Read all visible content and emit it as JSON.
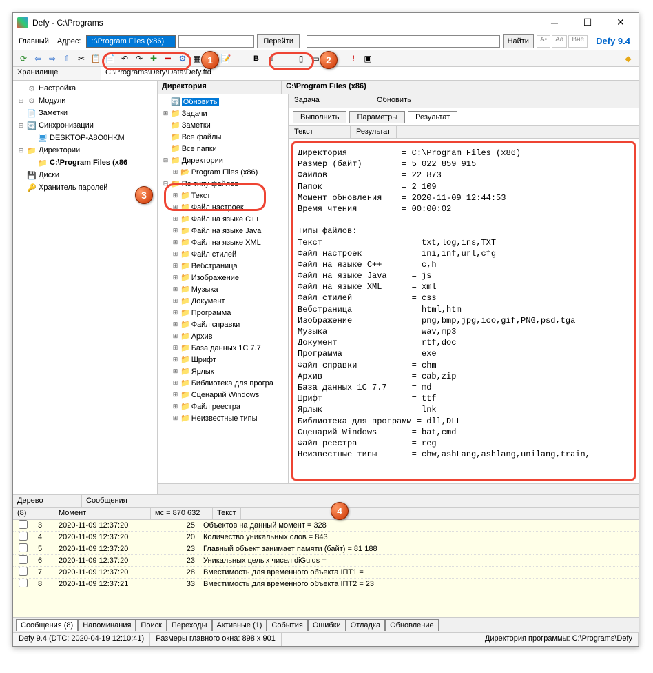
{
  "window": {
    "title": "Defy - C:\\Programs"
  },
  "addressbar": {
    "main_label": "Главный",
    "addr_label": "Адрес:",
    "addr_value": "::\\Program Files (x86)",
    "go_label": "Перейти",
    "find_label": "Найти",
    "font_a": "A•",
    "font_aa": "Aa",
    "font_vne": "Вне",
    "version": "Defy 9.4"
  },
  "pathbar": {
    "label": "Хранилище",
    "path": "C:\\Programs\\Defy\\Data\\Defy.ftd"
  },
  "tree": {
    "items": [
      {
        "exp": "",
        "ico": "gear",
        "txt": "Настройка",
        "ind": 0
      },
      {
        "exp": "⊞",
        "ico": "gear",
        "txt": "Модули",
        "ind": 0
      },
      {
        "exp": "",
        "ico": "note",
        "txt": "Заметки",
        "ind": 0
      },
      {
        "exp": "⊟",
        "ico": "sync",
        "txt": "Синхронизации",
        "ind": 0
      },
      {
        "exp": "",
        "ico": "comp",
        "txt": "DESKTOP-A8O0HKM",
        "ind": 1
      },
      {
        "exp": "⊟",
        "ico": "folder",
        "txt": "Директории",
        "ind": 0
      },
      {
        "exp": "",
        "ico": "folder",
        "txt": "C:\\Program Files (x86",
        "ind": 1,
        "bold": true
      },
      {
        "exp": "",
        "ico": "disk",
        "txt": "Диски",
        "ind": 0
      },
      {
        "exp": "",
        "ico": "key",
        "txt": "Хранитель паролей",
        "ind": 0
      }
    ]
  },
  "mid_header": {
    "col1": "Директория",
    "col2": "C:\\Program Files (x86)"
  },
  "filetree": {
    "items": [
      {
        "exp": "",
        "ico": "🔄",
        "txt": "Обновить",
        "ind": 0,
        "sel": true
      },
      {
        "exp": "⊞",
        "ico": "📁",
        "txt": "Задачи",
        "ind": 0
      },
      {
        "exp": "",
        "ico": "📁",
        "txt": "Заметки",
        "ind": 0
      },
      {
        "exp": "",
        "ico": "📁",
        "txt": "Все файлы",
        "ind": 0
      },
      {
        "exp": "",
        "ico": "📁",
        "txt": "Все папки",
        "ind": 0
      },
      {
        "exp": "⊟",
        "ico": "📁",
        "txt": "Директории",
        "ind": 0
      },
      {
        "exp": "⊞",
        "ico": "📂",
        "txt": "Program Files (x86)",
        "ind": 1,
        "yel": true
      },
      {
        "exp": "⊟",
        "ico": "📁",
        "txt": "По типу файлов",
        "ind": 0
      },
      {
        "exp": "⊞",
        "ico": "📁",
        "txt": "Текст",
        "ind": 1
      },
      {
        "exp": "⊞",
        "ico": "📁",
        "txt": "Файл настроек",
        "ind": 1
      },
      {
        "exp": "⊞",
        "ico": "📁",
        "txt": "Файл на языке C++",
        "ind": 1
      },
      {
        "exp": "⊞",
        "ico": "📁",
        "txt": "Файл на языке Java",
        "ind": 1
      },
      {
        "exp": "⊞",
        "ico": "📁",
        "txt": "Файл на языке XML",
        "ind": 1
      },
      {
        "exp": "⊞",
        "ico": "📁",
        "txt": "Файл стилей",
        "ind": 1
      },
      {
        "exp": "⊞",
        "ico": "📁",
        "txt": "Вебстраница",
        "ind": 1
      },
      {
        "exp": "⊞",
        "ico": "📁",
        "txt": "Изображение",
        "ind": 1
      },
      {
        "exp": "⊞",
        "ico": "📁",
        "txt": "Музыка",
        "ind": 1
      },
      {
        "exp": "⊞",
        "ico": "📁",
        "txt": "Документ",
        "ind": 1
      },
      {
        "exp": "⊞",
        "ico": "📁",
        "txt": "Программа",
        "ind": 1
      },
      {
        "exp": "⊞",
        "ico": "📁",
        "txt": "Файл справки",
        "ind": 1
      },
      {
        "exp": "⊞",
        "ico": "📁",
        "txt": "Архив",
        "ind": 1
      },
      {
        "exp": "⊞",
        "ico": "📁",
        "txt": "База данных 1С 7.7",
        "ind": 1
      },
      {
        "exp": "⊞",
        "ico": "📁",
        "txt": "Шрифт",
        "ind": 1
      },
      {
        "exp": "⊞",
        "ico": "📁",
        "txt": "Ярлык",
        "ind": 1
      },
      {
        "exp": "⊞",
        "ico": "📁",
        "txt": "Библиотека для програ",
        "ind": 1
      },
      {
        "exp": "⊞",
        "ico": "📁",
        "txt": "Сценарий Windows",
        "ind": 1
      },
      {
        "exp": "⊞",
        "ico": "📁",
        "txt": "Файл реестра",
        "ind": 1
      },
      {
        "exp": "⊞",
        "ico": "📁",
        "txt": "Неизвестные типы",
        "ind": 1
      }
    ]
  },
  "task": {
    "col1": "Задача",
    "col2": "Обновить"
  },
  "btns": {
    "b1": "Выполнить",
    "b2": "Параметры",
    "b3": "Результат"
  },
  "txthdr": {
    "c1": "Текст",
    "c2": "Результат"
  },
  "result_text": "Директория           = C:\\Program Files (x86)\nРазмер (байт)        = 5 022 859 915\nФайлов               = 22 873\nПапок                = 2 109\nМомент обновления    = 2020-11-09 12:44:53\nВремя чтения         = 00:00:02\n\nТипы файлов:\nТекст                  = txt,log,ins,TXT\nФайл настроек          = ini,inf,url,cfg\nФайл на языке C++      = c,h\nФайл на языке Java     = js\nФайл на языке XML      = xml\nФайл стилей            = css\nВебстраница            = html,htm\nИзображение            = png,bmp,jpg,ico,gif,PNG,psd,tga\nМузыка                 = wav,mp3\nДокумент               = rtf,doc\nПрограмма              = exe\nФайл справки           = chm\nАрхив                  = cab,zip\nБаза данных 1С 7.7     = md\nШрифт                  = ttf\nЯрлык                  = lnk\nБиблиотека для программ = dll,DLL\nСценарий Windows       = bat,cmd\nФайл реестра           = reg\nНеизвестные типы       = chw,ashLang,ashlang,unilang,train,",
  "bot": {
    "c1": "Дерево",
    "c2": "Сообщения"
  },
  "loghdr": {
    "c1": "(8)",
    "c2": "Момент",
    "c3": "мс = 870 632",
    "c4": "Текст"
  },
  "log": [
    {
      "id": "3",
      "ts": "2020-11-09 12:37:20",
      "ms": "25",
      "txt": "Объектов на данный момент        = 328"
    },
    {
      "id": "4",
      "ts": "2020-11-09 12:37:20",
      "ms": "20",
      "txt": "Количество уникальных слов       = 843"
    },
    {
      "id": "5",
      "ts": "2020-11-09 12:37:20",
      "ms": "23",
      "txt": "Главный объект занимает памяти (байт) = 81 188"
    },
    {
      "id": "6",
      "ts": "2020-11-09 12:37:20",
      "ms": "23",
      "txt": "Уникальных целых чисел diGuids ="
    },
    {
      "id": "7",
      "ts": "2020-11-09 12:37:20",
      "ms": "28",
      "txt": "Вместимость для временного объекта IПТ1 ="
    },
    {
      "id": "8",
      "ts": "2020-11-09 12:37:21",
      "ms": "33",
      "txt": "Вместимость для временного объекта IПТ2 = 23"
    }
  ],
  "tabs": [
    "Сообщения (8)",
    "Напоминания",
    "Поиск",
    "Переходы",
    "Активные (1)",
    "События",
    "Ошибки",
    "Отладка",
    "Обновление"
  ],
  "status": {
    "s1": "Defy 9.4 (DTC: 2020-04-19 12:10:41)",
    "s2": "Размеры главного окна: 898 x 901",
    "s3": "Директория программы: C:\\Programs\\Defy"
  }
}
